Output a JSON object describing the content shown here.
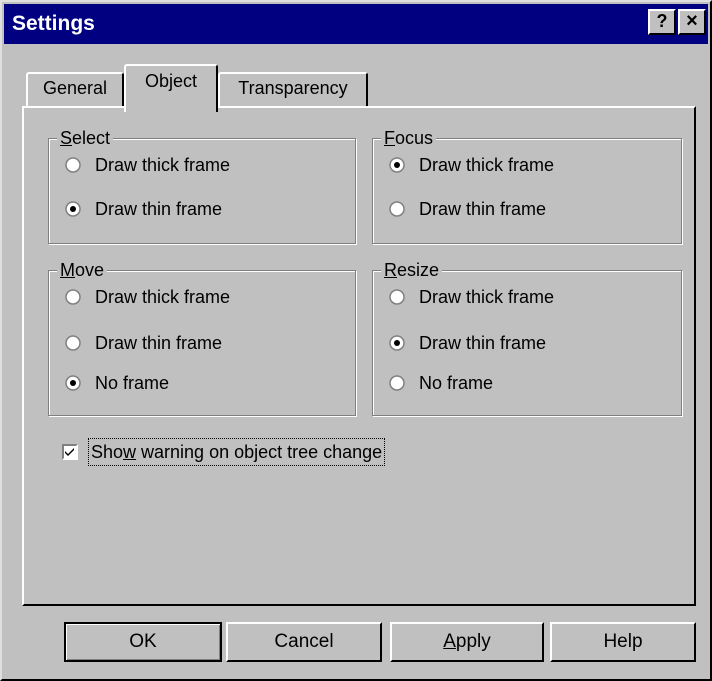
{
  "window": {
    "title": "Settings",
    "help_button": "?",
    "close_button": "×"
  },
  "tabs": [
    {
      "label": "General"
    },
    {
      "label": "Object",
      "selected": true
    },
    {
      "label": "Transparency"
    }
  ],
  "groups": {
    "select": {
      "title_prefix": "S",
      "title_rest": "elect",
      "options": [
        {
          "label": "Draw thick frame",
          "selected": false
        },
        {
          "label": "Draw thin frame",
          "selected": true
        }
      ]
    },
    "focus": {
      "title_prefix": "F",
      "title_rest": "ocus",
      "options": [
        {
          "label": "Draw thick frame",
          "selected": true
        },
        {
          "label": "Draw thin frame",
          "selected": false
        }
      ]
    },
    "move": {
      "title_prefix": "M",
      "title_rest": "ove",
      "options": [
        {
          "label": "Draw thick frame",
          "selected": false
        },
        {
          "label": "Draw thin frame",
          "selected": false
        },
        {
          "label": "No frame",
          "selected": true
        }
      ]
    },
    "resize": {
      "title_prefix": "R",
      "title_rest": "esize",
      "options": [
        {
          "label": "Draw thick frame",
          "selected": false
        },
        {
          "label": "Draw thin frame",
          "selected": true
        },
        {
          "label": "No frame",
          "selected": false
        }
      ]
    }
  },
  "checkbox": {
    "label_before": "Sho",
    "label_mnemonic": "w",
    "label_after": " warning on object tree change",
    "checked": true
  },
  "buttons": {
    "ok": "OK",
    "cancel": "Cancel",
    "apply_mnemonic": "A",
    "apply_rest": "pply",
    "help": "Help"
  },
  "colors": {
    "titlebar": "#000080",
    "face": "#c0c0c0"
  }
}
